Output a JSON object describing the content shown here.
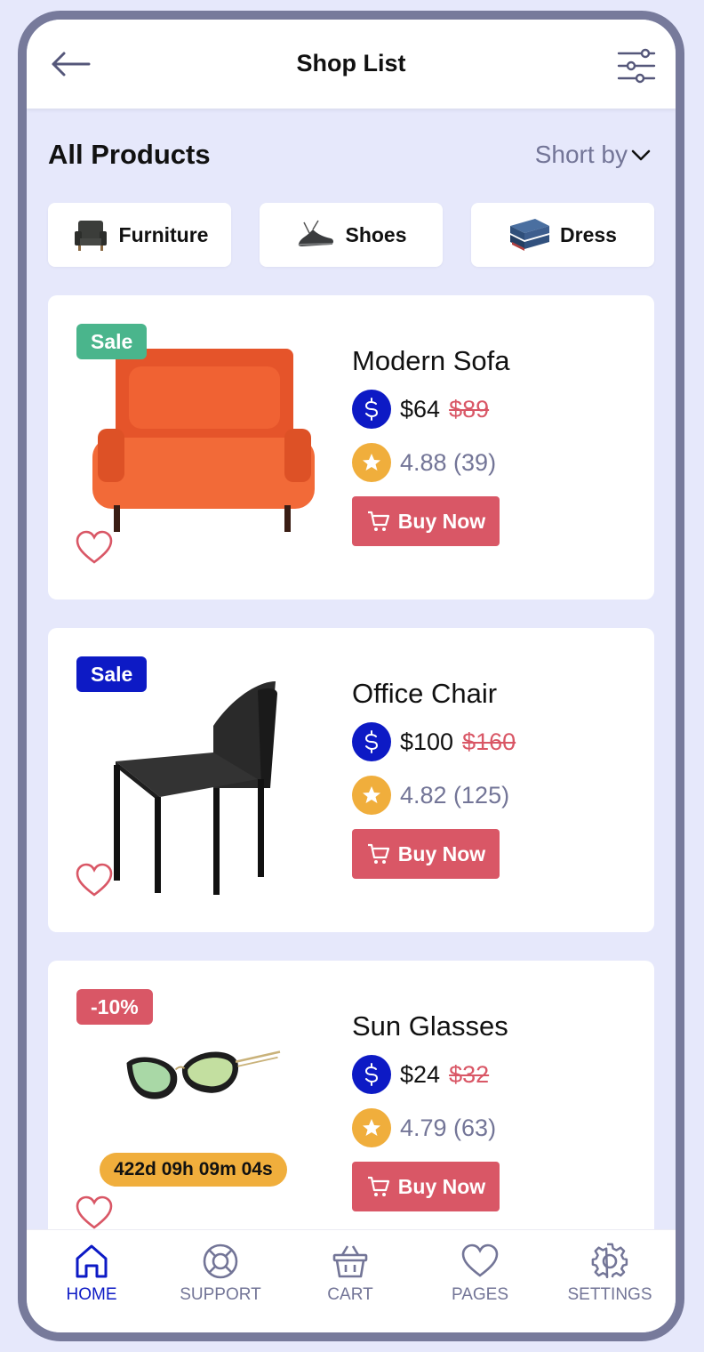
{
  "header": {
    "title": "Shop List"
  },
  "section": {
    "title": "All Products",
    "sort_label": "Short by"
  },
  "categories": [
    {
      "label": "Furniture",
      "icon": "armchair-icon"
    },
    {
      "label": "Shoes",
      "icon": "shoe-icon"
    },
    {
      "label": "Dress",
      "icon": "folded-clothes-icon"
    }
  ],
  "products": [
    {
      "badge": "Sale",
      "badge_color": "#4ab58c",
      "name": "Modern Sofa",
      "price": "$64",
      "old_price": "$89",
      "rating": "4.88 (39)",
      "buy_label": "Buy Now"
    },
    {
      "badge": "Sale",
      "badge_color": "#0d1ac5",
      "name": "Office Chair",
      "price": "$100",
      "old_price": "$160",
      "rating": "4.82 (125)",
      "buy_label": "Buy Now"
    },
    {
      "badge": "-10%",
      "badge_color": "#d95766",
      "name": "Sun Glasses",
      "price": "$24",
      "old_price": "$32",
      "rating": "4.79 (63)",
      "buy_label": "Buy Now",
      "timer": "422d 09h 09m 04s"
    }
  ],
  "nav": [
    {
      "label": "HOME",
      "icon": "home-icon",
      "active": true
    },
    {
      "label": "SUPPORT",
      "icon": "lifebuoy-icon",
      "active": false
    },
    {
      "label": "CART",
      "icon": "basket-icon",
      "active": false
    },
    {
      "label": "PAGES",
      "icon": "heart-icon",
      "active": false
    },
    {
      "label": "SETTINGS",
      "icon": "gear-icon",
      "active": false
    }
  ],
  "colors": {
    "accent": "#0d1ac5",
    "sale_red": "#d95766",
    "star": "#f0ae3c",
    "muted": "#737597",
    "background": "#e6e8fb"
  }
}
